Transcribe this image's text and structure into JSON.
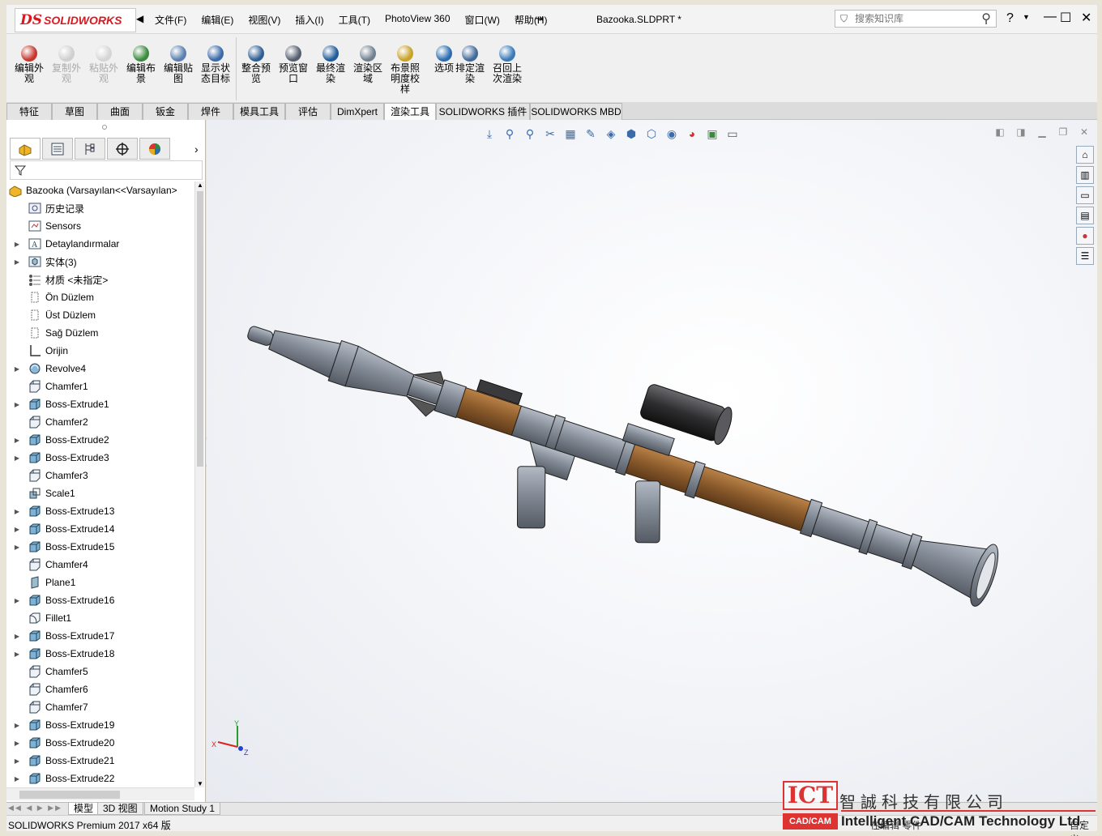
{
  "app": {
    "logo": {
      "ds": "DS",
      "name": "SOLIDWORKS"
    },
    "menu": [
      "文件(F)",
      "编辑(E)",
      "视图(V)",
      "插入(I)",
      "工具(T)",
      "PhotoView 360",
      "窗口(W)",
      "帮助(H)"
    ],
    "document_title": "Bazooka.SLDPRT *",
    "search_placeholder": "搜索知识库",
    "help_label": "?"
  },
  "commands": [
    {
      "label": "编辑外观",
      "enabled": true,
      "color": "#c8372d"
    },
    {
      "label": "复制外观",
      "enabled": false,
      "color": "#cfcfcf"
    },
    {
      "label": "粘贴外观",
      "enabled": false,
      "color": "#d5d5d5"
    },
    {
      "label": "编辑布景",
      "enabled": true,
      "color": "#3b8a3e"
    },
    {
      "label": "编辑贴图",
      "enabled": true,
      "color": "#5a7fb0"
    },
    {
      "label": "显示状态目标",
      "enabled": true,
      "color": "#3a6aa8"
    },
    {
      "label": "整合预览",
      "enabled": true,
      "color": "#2f5e94"
    },
    {
      "label": "预览窗口",
      "enabled": true,
      "color": "#555f6e"
    },
    {
      "label": "最终渲染",
      "enabled": true,
      "color": "#1f5c99"
    },
    {
      "label": "渲染区域",
      "enabled": true,
      "color": "#708090"
    },
    {
      "label": "布景照明度校样",
      "enabled": true,
      "color": "#c9a227"
    },
    {
      "label": "选项",
      "enabled": true,
      "color": "#2b6cb0"
    },
    {
      "label": "排定渲染",
      "enabled": true,
      "color": "#416a99"
    },
    {
      "label": "召回上次渲染",
      "enabled": true,
      "color": "#3a7ab8"
    }
  ],
  "tabs": [
    "特征",
    "草图",
    "曲面",
    "钣金",
    "焊件",
    "模具工具",
    "评估",
    "DimXpert",
    "渲染工具",
    "SOLIDWORKS 插件",
    "SOLIDWORKS MBD"
  ],
  "active_tab": "渲染工具",
  "tree": {
    "root": "Bazooka  (Varsayılan<<Varsayılan>",
    "items": [
      {
        "label": "历史记录",
        "icon": "history-icon",
        "expand": false
      },
      {
        "label": "Sensors",
        "icon": "sensor-icon",
        "expand": false
      },
      {
        "label": "Detaylandırmalar",
        "icon": "annotations-icon",
        "expand": true
      },
      {
        "label": "实体(3)",
        "icon": "solid-bodies-icon",
        "expand": true
      },
      {
        "label": "材质 <未指定>",
        "icon": "material-icon",
        "expand": false
      },
      {
        "label": "Ön Düzlem",
        "icon": "plane-icon",
        "expand": false
      },
      {
        "label": "Üst Düzlem",
        "icon": "plane-icon",
        "expand": false
      },
      {
        "label": "Sağ Düzlem",
        "icon": "plane-icon",
        "expand": false
      },
      {
        "label": "Orijin",
        "icon": "origin-icon",
        "expand": false
      },
      {
        "label": "Revolve4",
        "icon": "revolve-icon",
        "expand": true
      },
      {
        "label": "Chamfer1",
        "icon": "chamfer-icon",
        "expand": false
      },
      {
        "label": "Boss-Extrude1",
        "icon": "extrude-icon",
        "expand": true
      },
      {
        "label": "Chamfer2",
        "icon": "chamfer-icon",
        "expand": false
      },
      {
        "label": "Boss-Extrude2",
        "icon": "extrude-icon",
        "expand": true
      },
      {
        "label": "Boss-Extrude3",
        "icon": "extrude-icon",
        "expand": true
      },
      {
        "label": "Chamfer3",
        "icon": "chamfer-icon",
        "expand": false
      },
      {
        "label": "Scale1",
        "icon": "scale-icon",
        "expand": false
      },
      {
        "label": "Boss-Extrude13",
        "icon": "extrude-icon",
        "expand": true
      },
      {
        "label": "Boss-Extrude14",
        "icon": "extrude-icon",
        "expand": true
      },
      {
        "label": "Boss-Extrude15",
        "icon": "extrude-icon",
        "expand": true
      },
      {
        "label": "Chamfer4",
        "icon": "chamfer-icon",
        "expand": false
      },
      {
        "label": "Plane1",
        "icon": "plane-feature-icon",
        "expand": false
      },
      {
        "label": "Boss-Extrude16",
        "icon": "extrude-icon",
        "expand": true
      },
      {
        "label": "Fillet1",
        "icon": "fillet-icon",
        "expand": false
      },
      {
        "label": "Boss-Extrude17",
        "icon": "extrude-icon",
        "expand": true
      },
      {
        "label": "Boss-Extrude18",
        "icon": "extrude-icon",
        "expand": true
      },
      {
        "label": "Chamfer5",
        "icon": "chamfer-icon",
        "expand": false
      },
      {
        "label": "Chamfer6",
        "icon": "chamfer-icon",
        "expand": false
      },
      {
        "label": "Chamfer7",
        "icon": "chamfer-icon",
        "expand": false
      },
      {
        "label": "Boss-Extrude19",
        "icon": "extrude-icon",
        "expand": true
      },
      {
        "label": "Boss-Extrude20",
        "icon": "extrude-icon",
        "expand": true
      },
      {
        "label": "Boss-Extrude21",
        "icon": "extrude-icon",
        "expand": true
      },
      {
        "label": "Boss-Extrude22",
        "icon": "extrude-icon",
        "expand": true
      }
    ]
  },
  "bottom_tabs": [
    "模型",
    "3D 视图",
    "Motion Study 1"
  ],
  "active_bottom_tab": "模型",
  "status": {
    "left": "SOLIDWORKS Premium 2017 x64 版",
    "middle": "在编辑 零件",
    "right": "自定义"
  },
  "axes": {
    "x": "X",
    "y": "Y",
    "z": "Z"
  },
  "watermark": {
    "ict": "ICT",
    "cadcam": "CAD/CAM",
    "chinese": "智誠科技有限公司",
    "english": "Intelligent CAD/CAM Technology Ltd."
  },
  "colors": {
    "barrel_metal": "#7d8591",
    "wood": "#8a5a2b",
    "scope": "#2e2e30",
    "accent": "#d71920"
  }
}
